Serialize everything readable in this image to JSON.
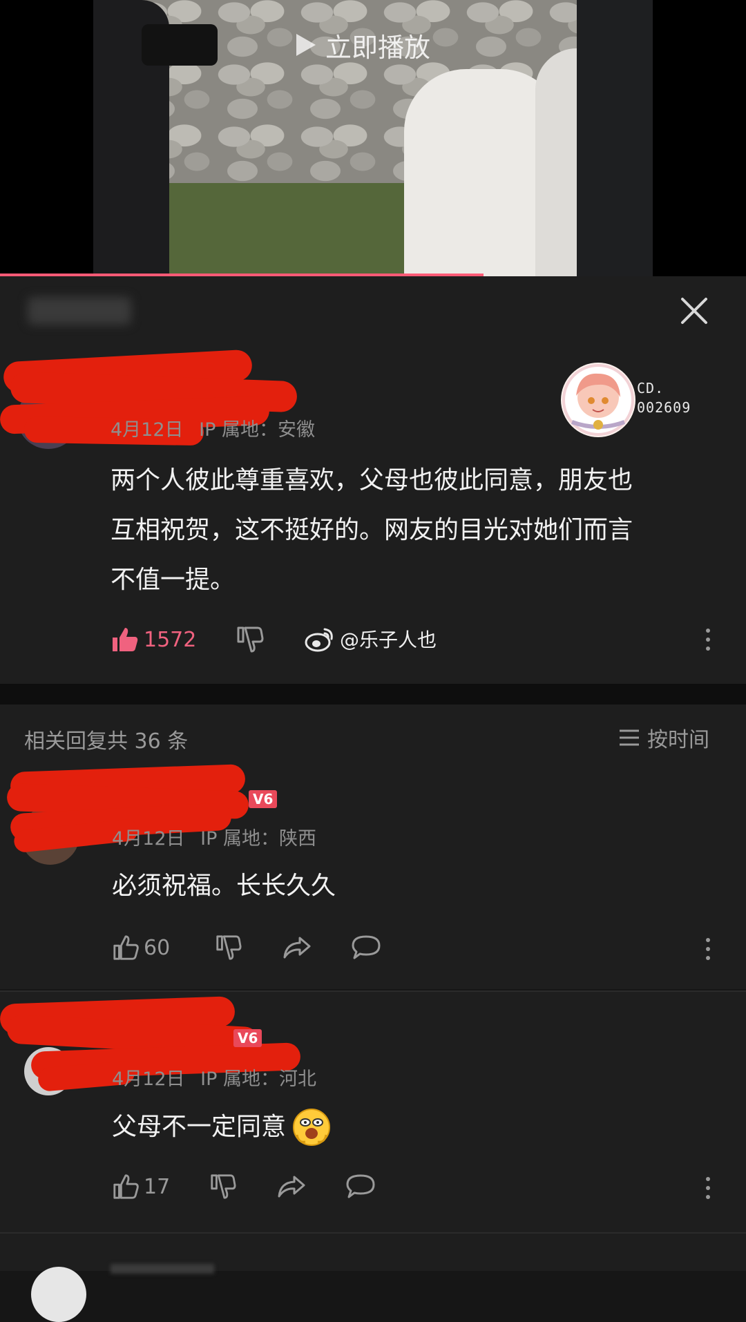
{
  "video": {
    "play_label": "立即播放"
  },
  "main_comment": {
    "ip_location": "IP 属地：安徽",
    "date_partial": "4月12日",
    "text_lines": [
      "两个人彼此尊重喜欢，父母也彼此同意，朋友也",
      "互相祝贺，这不挺好的。网友的目光对她们而言",
      "不值一提。"
    ],
    "badge_label_1": "CD.",
    "badge_label_2": "002609",
    "likes": "1572",
    "watermark": "@乐子人也"
  },
  "replies_header": {
    "count_label": "相关回复共 36 条",
    "sort_label": "按时间"
  },
  "replies": [
    {
      "level": "V6",
      "date": "4月12日",
      "ip": "IP 属地：陕西",
      "text": "必须祝福。长长久久",
      "likes": "60"
    },
    {
      "level": "V6",
      "date": "4月12日",
      "ip": "IP 属地：河北",
      "text": "父母不一定同意",
      "likes": "17"
    }
  ],
  "colors": {
    "accent": "#ff5a76",
    "scribble": "#e3200d",
    "liked": "#f0627f"
  }
}
